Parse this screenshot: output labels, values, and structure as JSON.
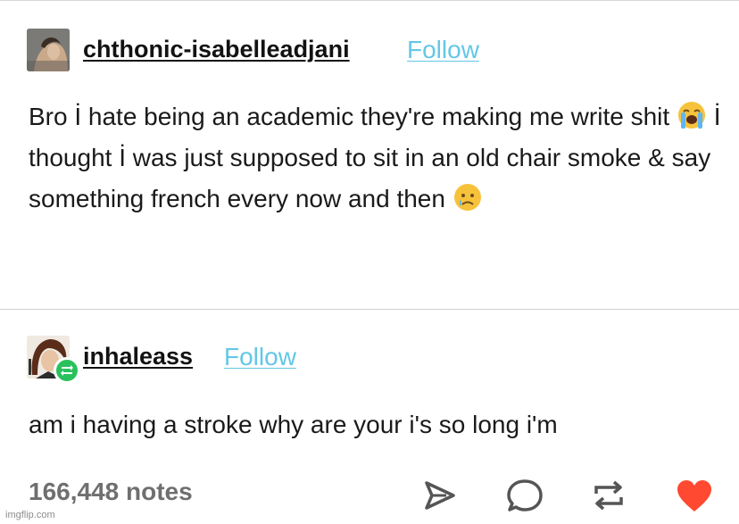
{
  "posts": [
    {
      "username": "chthonic-isabelleadjani",
      "follow_label": "Follow",
      "text_parts": [
        "Bro İ hate being an academic they're making me write shit",
        "İ thought İ was just supposed to sit in an old chair smoke & say something french every now and then"
      ],
      "emojis": [
        "loudly-crying-face-icon",
        "crying-face-icon"
      ]
    },
    {
      "username": "inhaleass",
      "follow_label": "Follow",
      "text": "am i having a stroke why are your i's so long i'm"
    }
  ],
  "footer": {
    "notes": "166,448 notes",
    "actions": [
      "share-icon",
      "reply-icon",
      "reblog-icon",
      "like-icon"
    ],
    "like_color": "#ff4930"
  },
  "watermark": "imgflip.com",
  "colors": {
    "follow": "#63c7e6",
    "reblog_badge": "#29c15e"
  }
}
